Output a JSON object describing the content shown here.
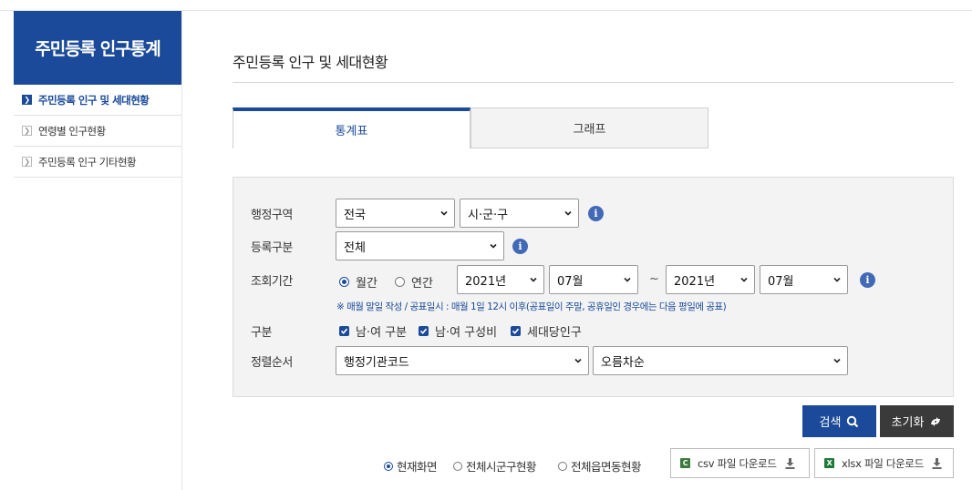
{
  "sidebar": {
    "title": "주민등록 인구통계",
    "items": [
      {
        "label": "주민등록 인구 및 세대현황",
        "active": true
      },
      {
        "label": "연령별 인구현황",
        "active": false
      },
      {
        "label": "주민등록 인구 기타현황",
        "active": false
      }
    ]
  },
  "main": {
    "title": "주민등록 인구 및 세대현황",
    "tabs": [
      {
        "label": "통계표",
        "active": true
      },
      {
        "label": "그래프",
        "active": false
      }
    ]
  },
  "form": {
    "region": {
      "label": "행정구역",
      "sido": "전국",
      "sigungu": "시·군·구"
    },
    "registration": {
      "label": "등록구분",
      "value": "전체"
    },
    "period": {
      "label": "조회기간",
      "monthly": "월간",
      "yearly": "연간",
      "selected": "monthly",
      "from_year": "2021년",
      "from_month": "07월",
      "tilde": "~",
      "to_year": "2021년",
      "to_month": "07월",
      "note": "※ 매월 말일 작성 / 공표일시 : 매월 1일 12시 이후(공표일이 주말, 공휴일인 경우에는 다음 평일에 공표)"
    },
    "category": {
      "label": "구분",
      "options": [
        "남·여 구분",
        "남·여 구성비",
        "세대당인구"
      ]
    },
    "sort": {
      "label": "정렬순서",
      "field": "행정기관코드",
      "order": "오름차순"
    },
    "info_glyph": "i"
  },
  "actions": {
    "search": "검색",
    "reset": "초기화"
  },
  "view_options": {
    "selected": "현재화면",
    "items": [
      "현재화면",
      "전체시군구현황",
      "전체읍면동현황"
    ]
  },
  "downloads": {
    "csv": {
      "label": "csv 파일 다운로드",
      "icon_letter": "C",
      "color": "#3d7a3d"
    },
    "xlsx": {
      "label": "xlsx 파일 다운로드",
      "icon_letter": "X",
      "color": "#1f7a3a"
    }
  },
  "colors": {
    "primary": "#1a4a99",
    "info": "#4169b6",
    "reset_button": "#3a3a3a"
  }
}
